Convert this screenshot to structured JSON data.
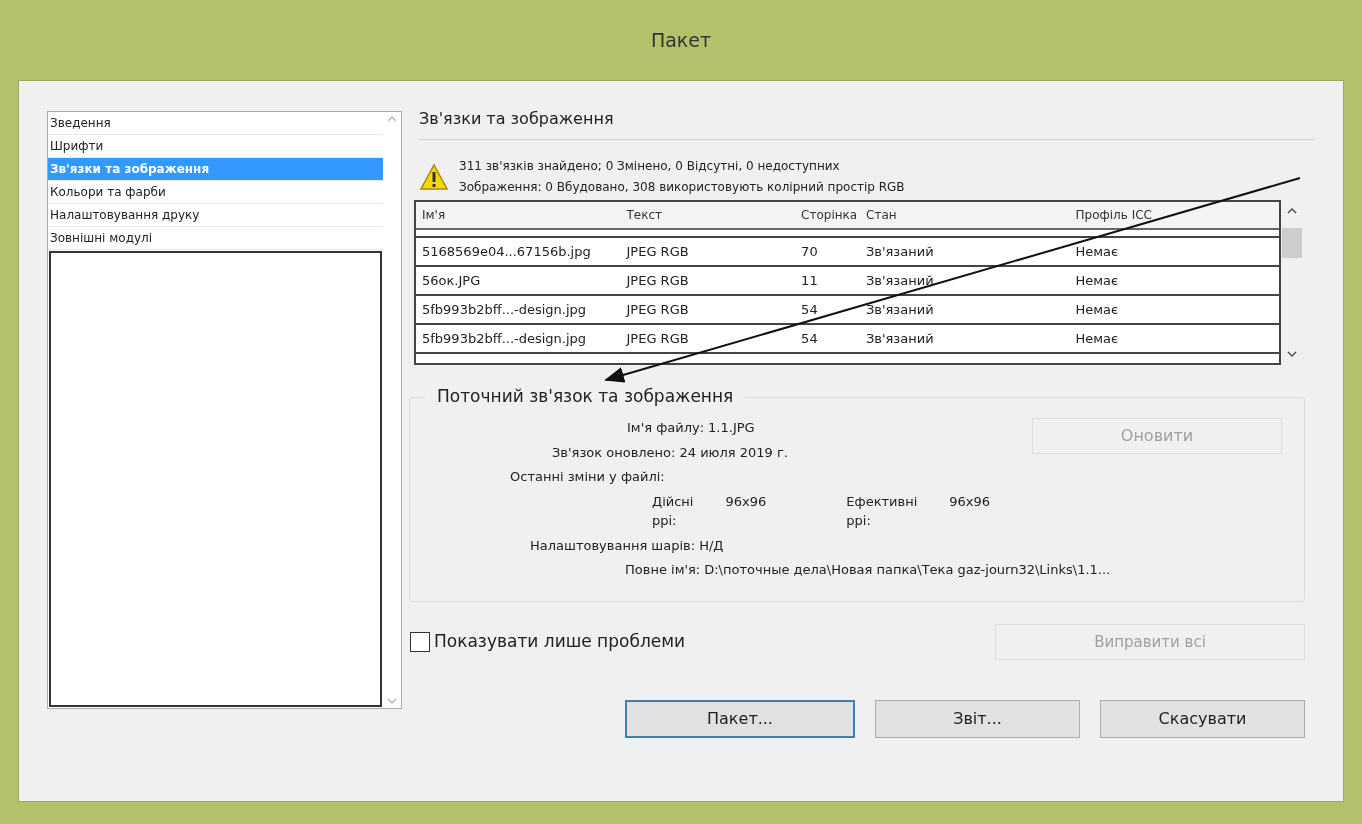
{
  "window": {
    "title": "Пакет"
  },
  "sidebar": {
    "items": [
      {
        "label": "Зведення",
        "selected": false
      },
      {
        "label": "Шрифти",
        "selected": false
      },
      {
        "label": "Зв'язки та зображення",
        "selected": true
      },
      {
        "label": "Кольори та фарби",
        "selected": false
      },
      {
        "label": "Налаштовування друку",
        "selected": false
      },
      {
        "label": "Зовнішні модулі",
        "selected": false
      }
    ]
  },
  "section_title": "Зв'язки та зображення",
  "summary": [
    "311 зв'язків знайдено; 0 Змінено, 0 Відсутні, 0 недоступних",
    "Зображення: 0 Вбудовано, 308 використовують колірний простір RGB"
  ],
  "table": {
    "columns": [
      "Ім'я",
      "Текст",
      "Сторінка",
      "Стан",
      "Профіль ICC"
    ],
    "rows": [
      [
        "5168569e04...67156b.jpg",
        "JPEG RGB",
        "70",
        "Зв'язаний",
        "Немає"
      ],
      [
        "56ок.JPG",
        "JPEG RGB",
        "11",
        "Зв'язаний",
        "Немає"
      ],
      [
        "5fb993b2bff...-design.jpg",
        "JPEG RGB",
        "54",
        "Зв'язаний",
        "Немає"
      ],
      [
        "5fb993b2bff...-design.jpg",
        "JPEG RGB",
        "54",
        "Зв'язаний",
        "Немає"
      ]
    ]
  },
  "current": {
    "title": "Поточний зв'язок та зображення",
    "file_name": {
      "label": "Ім'я файлу:",
      "value": "1.1.JPG"
    },
    "updated": {
      "label": "Зв'язок оновлено:",
      "value": "24 июля 2019 г."
    },
    "last_modified": {
      "label": "Останні зміни у файлі:"
    },
    "actual_ppi": {
      "label": "Дійсні ppi:",
      "value": "96x96"
    },
    "effective_ppi": {
      "label": "Ефективні ppi:",
      "value": "96x96"
    },
    "layers": {
      "label": "Налаштовування шарів:",
      "value": "Н/Д"
    },
    "full_name": {
      "label": "Повне ім'я:",
      "value": "D:\\поточные дела\\Новая папка\\Тека gaz-journ32\\Links\\1.1..."
    },
    "update_button": {
      "label": "Оновити",
      "disabled": true
    }
  },
  "show_problems": {
    "label": "Показувати лише проблеми",
    "checked": false
  },
  "fix_all_button": {
    "label": "Виправити всі",
    "disabled": true
  },
  "buttons": [
    "Пакет...",
    "Звіт...",
    "Скасувати"
  ]
}
